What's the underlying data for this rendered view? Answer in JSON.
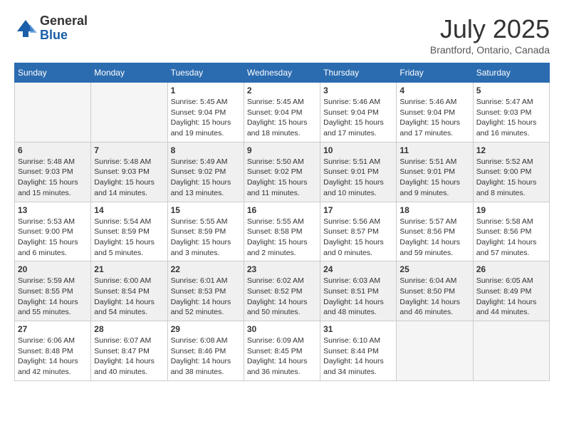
{
  "logo": {
    "general": "General",
    "blue": "Blue"
  },
  "title": "July 2025",
  "subtitle": "Brantford, Ontario, Canada",
  "days_of_week": [
    "Sunday",
    "Monday",
    "Tuesday",
    "Wednesday",
    "Thursday",
    "Friday",
    "Saturday"
  ],
  "weeks": [
    [
      {
        "day": "",
        "info": ""
      },
      {
        "day": "",
        "info": ""
      },
      {
        "day": "1",
        "info": "Sunrise: 5:45 AM\nSunset: 9:04 PM\nDaylight: 15 hours and 19 minutes."
      },
      {
        "day": "2",
        "info": "Sunrise: 5:45 AM\nSunset: 9:04 PM\nDaylight: 15 hours and 18 minutes."
      },
      {
        "day": "3",
        "info": "Sunrise: 5:46 AM\nSunset: 9:04 PM\nDaylight: 15 hours and 17 minutes."
      },
      {
        "day": "4",
        "info": "Sunrise: 5:46 AM\nSunset: 9:04 PM\nDaylight: 15 hours and 17 minutes."
      },
      {
        "day": "5",
        "info": "Sunrise: 5:47 AM\nSunset: 9:03 PM\nDaylight: 15 hours and 16 minutes."
      }
    ],
    [
      {
        "day": "6",
        "info": "Sunrise: 5:48 AM\nSunset: 9:03 PM\nDaylight: 15 hours and 15 minutes."
      },
      {
        "day": "7",
        "info": "Sunrise: 5:48 AM\nSunset: 9:03 PM\nDaylight: 15 hours and 14 minutes."
      },
      {
        "day": "8",
        "info": "Sunrise: 5:49 AM\nSunset: 9:02 PM\nDaylight: 15 hours and 13 minutes."
      },
      {
        "day": "9",
        "info": "Sunrise: 5:50 AM\nSunset: 9:02 PM\nDaylight: 15 hours and 11 minutes."
      },
      {
        "day": "10",
        "info": "Sunrise: 5:51 AM\nSunset: 9:01 PM\nDaylight: 15 hours and 10 minutes."
      },
      {
        "day": "11",
        "info": "Sunrise: 5:51 AM\nSunset: 9:01 PM\nDaylight: 15 hours and 9 minutes."
      },
      {
        "day": "12",
        "info": "Sunrise: 5:52 AM\nSunset: 9:00 PM\nDaylight: 15 hours and 8 minutes."
      }
    ],
    [
      {
        "day": "13",
        "info": "Sunrise: 5:53 AM\nSunset: 9:00 PM\nDaylight: 15 hours and 6 minutes."
      },
      {
        "day": "14",
        "info": "Sunrise: 5:54 AM\nSunset: 8:59 PM\nDaylight: 15 hours and 5 minutes."
      },
      {
        "day": "15",
        "info": "Sunrise: 5:55 AM\nSunset: 8:59 PM\nDaylight: 15 hours and 3 minutes."
      },
      {
        "day": "16",
        "info": "Sunrise: 5:55 AM\nSunset: 8:58 PM\nDaylight: 15 hours and 2 minutes."
      },
      {
        "day": "17",
        "info": "Sunrise: 5:56 AM\nSunset: 8:57 PM\nDaylight: 15 hours and 0 minutes."
      },
      {
        "day": "18",
        "info": "Sunrise: 5:57 AM\nSunset: 8:56 PM\nDaylight: 14 hours and 59 minutes."
      },
      {
        "day": "19",
        "info": "Sunrise: 5:58 AM\nSunset: 8:56 PM\nDaylight: 14 hours and 57 minutes."
      }
    ],
    [
      {
        "day": "20",
        "info": "Sunrise: 5:59 AM\nSunset: 8:55 PM\nDaylight: 14 hours and 55 minutes."
      },
      {
        "day": "21",
        "info": "Sunrise: 6:00 AM\nSunset: 8:54 PM\nDaylight: 14 hours and 54 minutes."
      },
      {
        "day": "22",
        "info": "Sunrise: 6:01 AM\nSunset: 8:53 PM\nDaylight: 14 hours and 52 minutes."
      },
      {
        "day": "23",
        "info": "Sunrise: 6:02 AM\nSunset: 8:52 PM\nDaylight: 14 hours and 50 minutes."
      },
      {
        "day": "24",
        "info": "Sunrise: 6:03 AM\nSunset: 8:51 PM\nDaylight: 14 hours and 48 minutes."
      },
      {
        "day": "25",
        "info": "Sunrise: 6:04 AM\nSunset: 8:50 PM\nDaylight: 14 hours and 46 minutes."
      },
      {
        "day": "26",
        "info": "Sunrise: 6:05 AM\nSunset: 8:49 PM\nDaylight: 14 hours and 44 minutes."
      }
    ],
    [
      {
        "day": "27",
        "info": "Sunrise: 6:06 AM\nSunset: 8:48 PM\nDaylight: 14 hours and 42 minutes."
      },
      {
        "day": "28",
        "info": "Sunrise: 6:07 AM\nSunset: 8:47 PM\nDaylight: 14 hours and 40 minutes."
      },
      {
        "day": "29",
        "info": "Sunrise: 6:08 AM\nSunset: 8:46 PM\nDaylight: 14 hours and 38 minutes."
      },
      {
        "day": "30",
        "info": "Sunrise: 6:09 AM\nSunset: 8:45 PM\nDaylight: 14 hours and 36 minutes."
      },
      {
        "day": "31",
        "info": "Sunrise: 6:10 AM\nSunset: 8:44 PM\nDaylight: 14 hours and 34 minutes."
      },
      {
        "day": "",
        "info": ""
      },
      {
        "day": "",
        "info": ""
      }
    ]
  ]
}
